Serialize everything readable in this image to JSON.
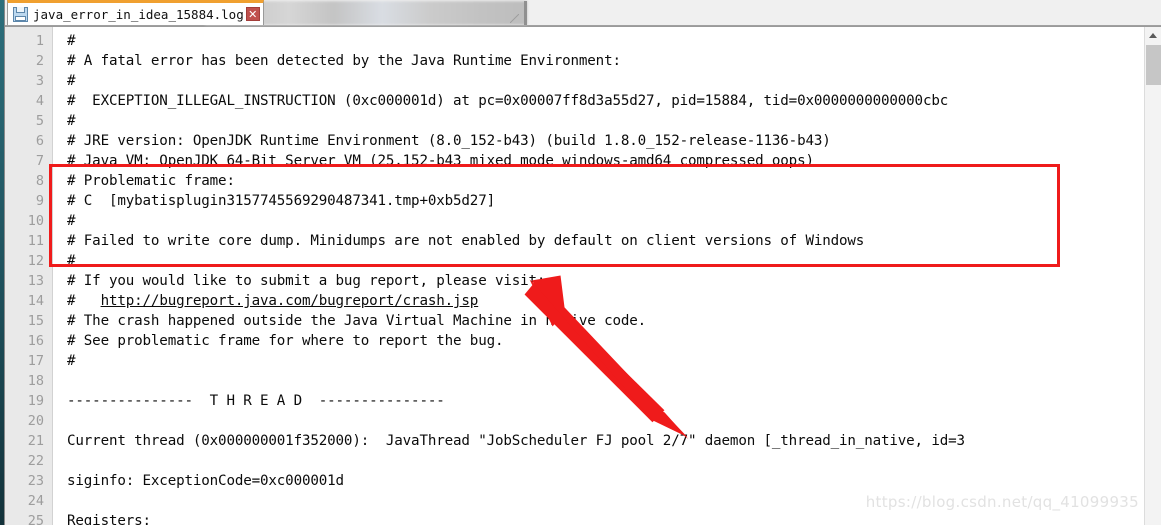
{
  "window": {
    "title": "java_error_in_idea_15884.log"
  },
  "tab_bar": {
    "active_tab": {
      "label": "java_error_in_idea_15884.log",
      "icon": "disk-save-icon",
      "close_label": "✕"
    }
  },
  "editor": {
    "first_visible_line": 1,
    "line_numbers": [
      1,
      2,
      3,
      4,
      5,
      6,
      7,
      8,
      9,
      10,
      11,
      12,
      13,
      14,
      15,
      16,
      17,
      18,
      19,
      20,
      21,
      22,
      23,
      24,
      25
    ],
    "lines": [
      {
        "n": 1,
        "text": "#"
      },
      {
        "n": 2,
        "text": "# A fatal error has been detected by the Java Runtime Environment:"
      },
      {
        "n": 3,
        "text": "#"
      },
      {
        "n": 4,
        "text": "#  EXCEPTION_ILLEGAL_INSTRUCTION (0xc000001d) at pc=0x00007ff8d3a55d27, pid=15884, tid=0x0000000000000cbc"
      },
      {
        "n": 5,
        "text": "#"
      },
      {
        "n": 6,
        "text": "# JRE version: OpenJDK Runtime Environment (8.0_152-b43) (build 1.8.0_152-release-1136-b43)"
      },
      {
        "n": 7,
        "text": "# Java VM: OpenJDK 64-Bit Server VM (25.152-b43 mixed mode windows-amd64 compressed oops)"
      },
      {
        "n": 8,
        "text": "# Problematic frame:"
      },
      {
        "n": 9,
        "text": "# C  [mybatisplugin3157745569290487341.tmp+0xb5d27]"
      },
      {
        "n": 10,
        "text": "#"
      },
      {
        "n": 11,
        "text": "# Failed to write core dump. Minidumps are not enabled by default on client versions of Windows"
      },
      {
        "n": 12,
        "text": "#"
      },
      {
        "n": 13,
        "text": "# If you would like to submit a bug report, please visit:"
      },
      {
        "n": 14,
        "text": "#   http://bugreport.java.com/bugreport/crash.jsp",
        "link": true,
        "link_text": "http://bugreport.java.com/bugreport/crash.jsp",
        "prefix": "#   "
      },
      {
        "n": 15,
        "text": "# The crash happened outside the Java Virtual Machine in native code."
      },
      {
        "n": 16,
        "text": "# See problematic frame for where to report the bug."
      },
      {
        "n": 17,
        "text": "#"
      },
      {
        "n": 18,
        "text": ""
      },
      {
        "n": 19,
        "text": "---------------  T H R E A D  ---------------"
      },
      {
        "n": 20,
        "text": ""
      },
      {
        "n": 21,
        "text": "Current thread (0x000000001f352000):  JavaThread \"JobScheduler FJ pool 2/7\" daemon [_thread_in_native, id=3"
      },
      {
        "n": 22,
        "text": ""
      },
      {
        "n": 23,
        "text": "siginfo: ExceptionCode=0xc000001d"
      },
      {
        "n": 24,
        "text": ""
      },
      {
        "n": 25,
        "text": "Registers:"
      }
    ]
  },
  "scrollbar": {
    "up_arrow": "scroll-up-arrow",
    "thumb_position_percent": 4
  },
  "annotations": {
    "highlight_box": {
      "color": "#ef1b1b",
      "covers_lines": "8-12"
    },
    "arrow": {
      "color": "#ef1b1b",
      "points_to_line": 13
    }
  },
  "watermark": {
    "text": "https://blog.csdn.net/qq_41099935"
  }
}
